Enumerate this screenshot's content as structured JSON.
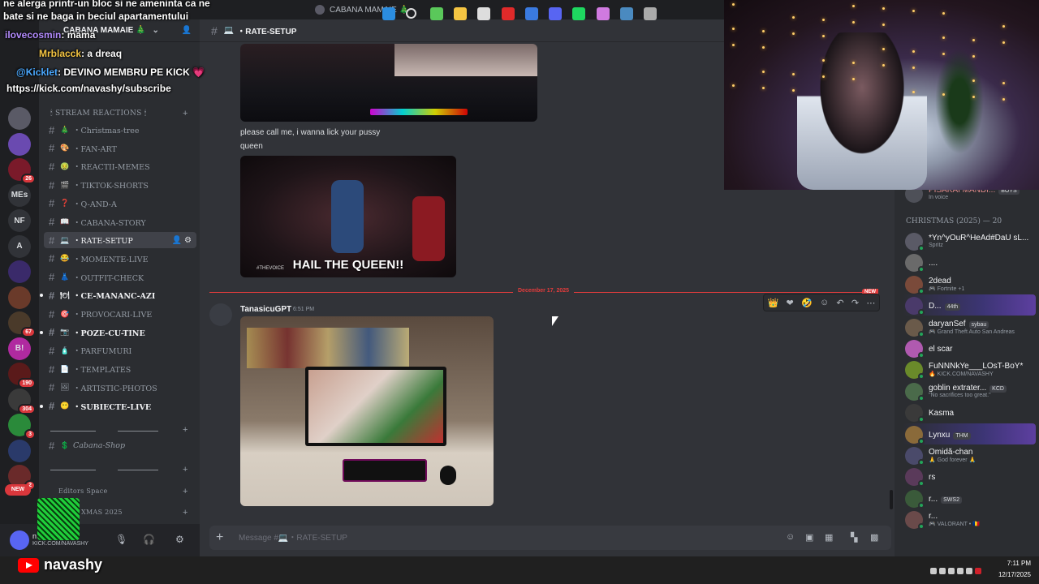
{
  "app": {
    "title": "CABANA MAMAIE 🎄",
    "server_name": "CABANA MAMAIE 🎄"
  },
  "rail": {
    "servers": [
      {
        "label": "",
        "badge": ""
      },
      {
        "label": "",
        "badge": ""
      },
      {
        "label": "",
        "badge": "26"
      },
      {
        "label": "MEs",
        "badge": ""
      },
      {
        "label": "NF",
        "badge": ""
      },
      {
        "label": "A",
        "badge": ""
      },
      {
        "label": "",
        "badge": ""
      },
      {
        "label": "",
        "badge": ""
      },
      {
        "label": "",
        "badge": "67"
      },
      {
        "label": "B!",
        "badge": ""
      },
      {
        "label": "",
        "badge": "190"
      },
      {
        "label": "",
        "badge": "304"
      },
      {
        "label": "",
        "badge": "3"
      },
      {
        "label": "",
        "badge": ""
      },
      {
        "label": "",
        "badge": "2"
      },
      {
        "label": "NEW",
        "badge": ""
      }
    ]
  },
  "sidebar": {
    "category_reactions": "🕯 STREAM REACTIONS 🕯",
    "channels": [
      {
        "emoji": "🎄",
        "name": "・Christmas-tree",
        "active": false,
        "bold": false,
        "italic": false
      },
      {
        "emoji": "🎨",
        "name": "・FAN-ART",
        "active": false,
        "bold": false,
        "italic": false
      },
      {
        "emoji": "🤢",
        "name": "・REACTII-MEMES",
        "active": false,
        "bold": false,
        "italic": false
      },
      {
        "emoji": "🎬",
        "name": "・TIKTOK-SHORTS",
        "active": false,
        "bold": false,
        "italic": false
      },
      {
        "emoji": "❓",
        "name": "・Q-AND-A",
        "active": false,
        "bold": false,
        "italic": false
      },
      {
        "emoji": "📖",
        "name": "・CABANA-STORY",
        "active": false,
        "bold": false,
        "italic": false
      },
      {
        "emoji": "💻",
        "name": "・RATE-SETUP",
        "active": true,
        "bold": false,
        "italic": false
      },
      {
        "emoji": "😂",
        "name": "・MOMENTE-LIVE",
        "active": false,
        "bold": false,
        "italic": false
      },
      {
        "emoji": "👗",
        "name": "・OUTFIT-CHECK",
        "active": false,
        "bold": false,
        "italic": false
      },
      {
        "emoji": "🍽",
        "name": "・CE-MANANC-AZI",
        "active": false,
        "bold": true,
        "italic": false
      },
      {
        "emoji": "🎯",
        "name": "・PROVOCARI-LIVE",
        "active": false,
        "bold": false,
        "italic": false
      },
      {
        "emoji": "📷",
        "name": "・POZE-CU-TINE",
        "active": false,
        "bold": true,
        "italic": false
      },
      {
        "emoji": "🧴",
        "name": "・PARFUMURI",
        "active": false,
        "bold": false,
        "italic": false
      },
      {
        "emoji": "📄",
        "name": "・TEMPLATES",
        "active": false,
        "bold": false,
        "italic": false
      },
      {
        "emoji": "🖼",
        "name": "・ARTISTIC-PHOTOS",
        "active": false,
        "bold": false,
        "italic": false
      },
      {
        "emoji": "😶",
        "name": "・SUBIECTE-LIVE",
        "active": false,
        "bold": true,
        "italic": false
      }
    ],
    "shop_channel": {
      "emoji": "💲",
      "name": "Cabana-Shop"
    },
    "editors_space": "Editors Space",
    "christmas_cat": "XMAS 2025"
  },
  "user_panel": {
    "name": "n",
    "status": "KICK.COM/NAVASHY"
  },
  "chat": {
    "channel_name": "・RATE-SETUP",
    "message_text_1": "please call me, i wanna lick your pussy",
    "message_text_2": "queen",
    "gif_caption": "HAIL THE QUEEN!!",
    "gif_watermark": "#THEVOICE",
    "date_divider": "December 17, 2025",
    "new_tag": "NEW",
    "author": "TanasicuGPT",
    "time": "6:51 PM",
    "composer_placeholder": "Message #💻・RATE-SETUP"
  },
  "members": {
    "top_member": {
      "name": "PISAKAI MANDI...",
      "status": "In voice",
      "tag": "BOYS"
    },
    "group_header": "CHRISTMAS (2025) — 20",
    "list": [
      {
        "name": "*Yn^yOuR^HeAd#DaU sL...",
        "status": "Spritz",
        "tag": ""
      },
      {
        "name": "....",
        "status": "",
        "tag": ""
      },
      {
        "name": "2dead",
        "status": "🎮 Fortnite +1",
        "tag": ""
      },
      {
        "name": "D...",
        "status": "",
        "tag": "44th"
      },
      {
        "name": "daryanSef",
        "status": "🎮 Grand Theft Auto San Andreas",
        "tag": "sybau"
      },
      {
        "name": "el scar",
        "status": "",
        "tag": ""
      },
      {
        "name": "FuNNNkYe___LOsT-BoY*",
        "status": "🔥 KICK.COM/NAVASHY",
        "tag": ""
      },
      {
        "name": "goblin extrater...",
        "status": "\"No sacrifices too great.\"",
        "tag": "KCD"
      },
      {
        "name": "Kasma",
        "status": "",
        "tag": ""
      },
      {
        "name": "Lynxu",
        "status": "",
        "tag": "THM"
      },
      {
        "name": "Omidă-chan",
        "status": "🙏 God forever 🙏",
        "tag": ""
      },
      {
        "name": "rs",
        "status": "",
        "tag": ""
      },
      {
        "name": "r...",
        "status": "",
        "tag": "SWS2"
      },
      {
        "name": "r...",
        "status": "🎮 VALORANT • 🇷🇴",
        "tag": ""
      }
    ]
  },
  "overlay": {
    "line1": "ne alerga printr-un bloc si ne ameninta ca ne",
    "line2": "bate si ne baga in beciul apartamentului",
    "chat": [
      {
        "user": "ilovecosmin",
        "text": ": mama"
      },
      {
        "user": "Mrblacck",
        "text": ": a dreaq"
      },
      {
        "user": "@Kicklet",
        "text": ": DEVINO MEMBRU PE KICK 💗"
      }
    ],
    "link": "https://kick.com/navashy/subscribe",
    "streamer": "navashy"
  },
  "taskbar": {
    "time": "7:11 PM",
    "date": "12/17/2025"
  },
  "colors": {
    "accent_red": "#e23c3c",
    "online_green": "#23a559",
    "channel_active_bg": "#404249",
    "kick_green": "#53fc18"
  }
}
